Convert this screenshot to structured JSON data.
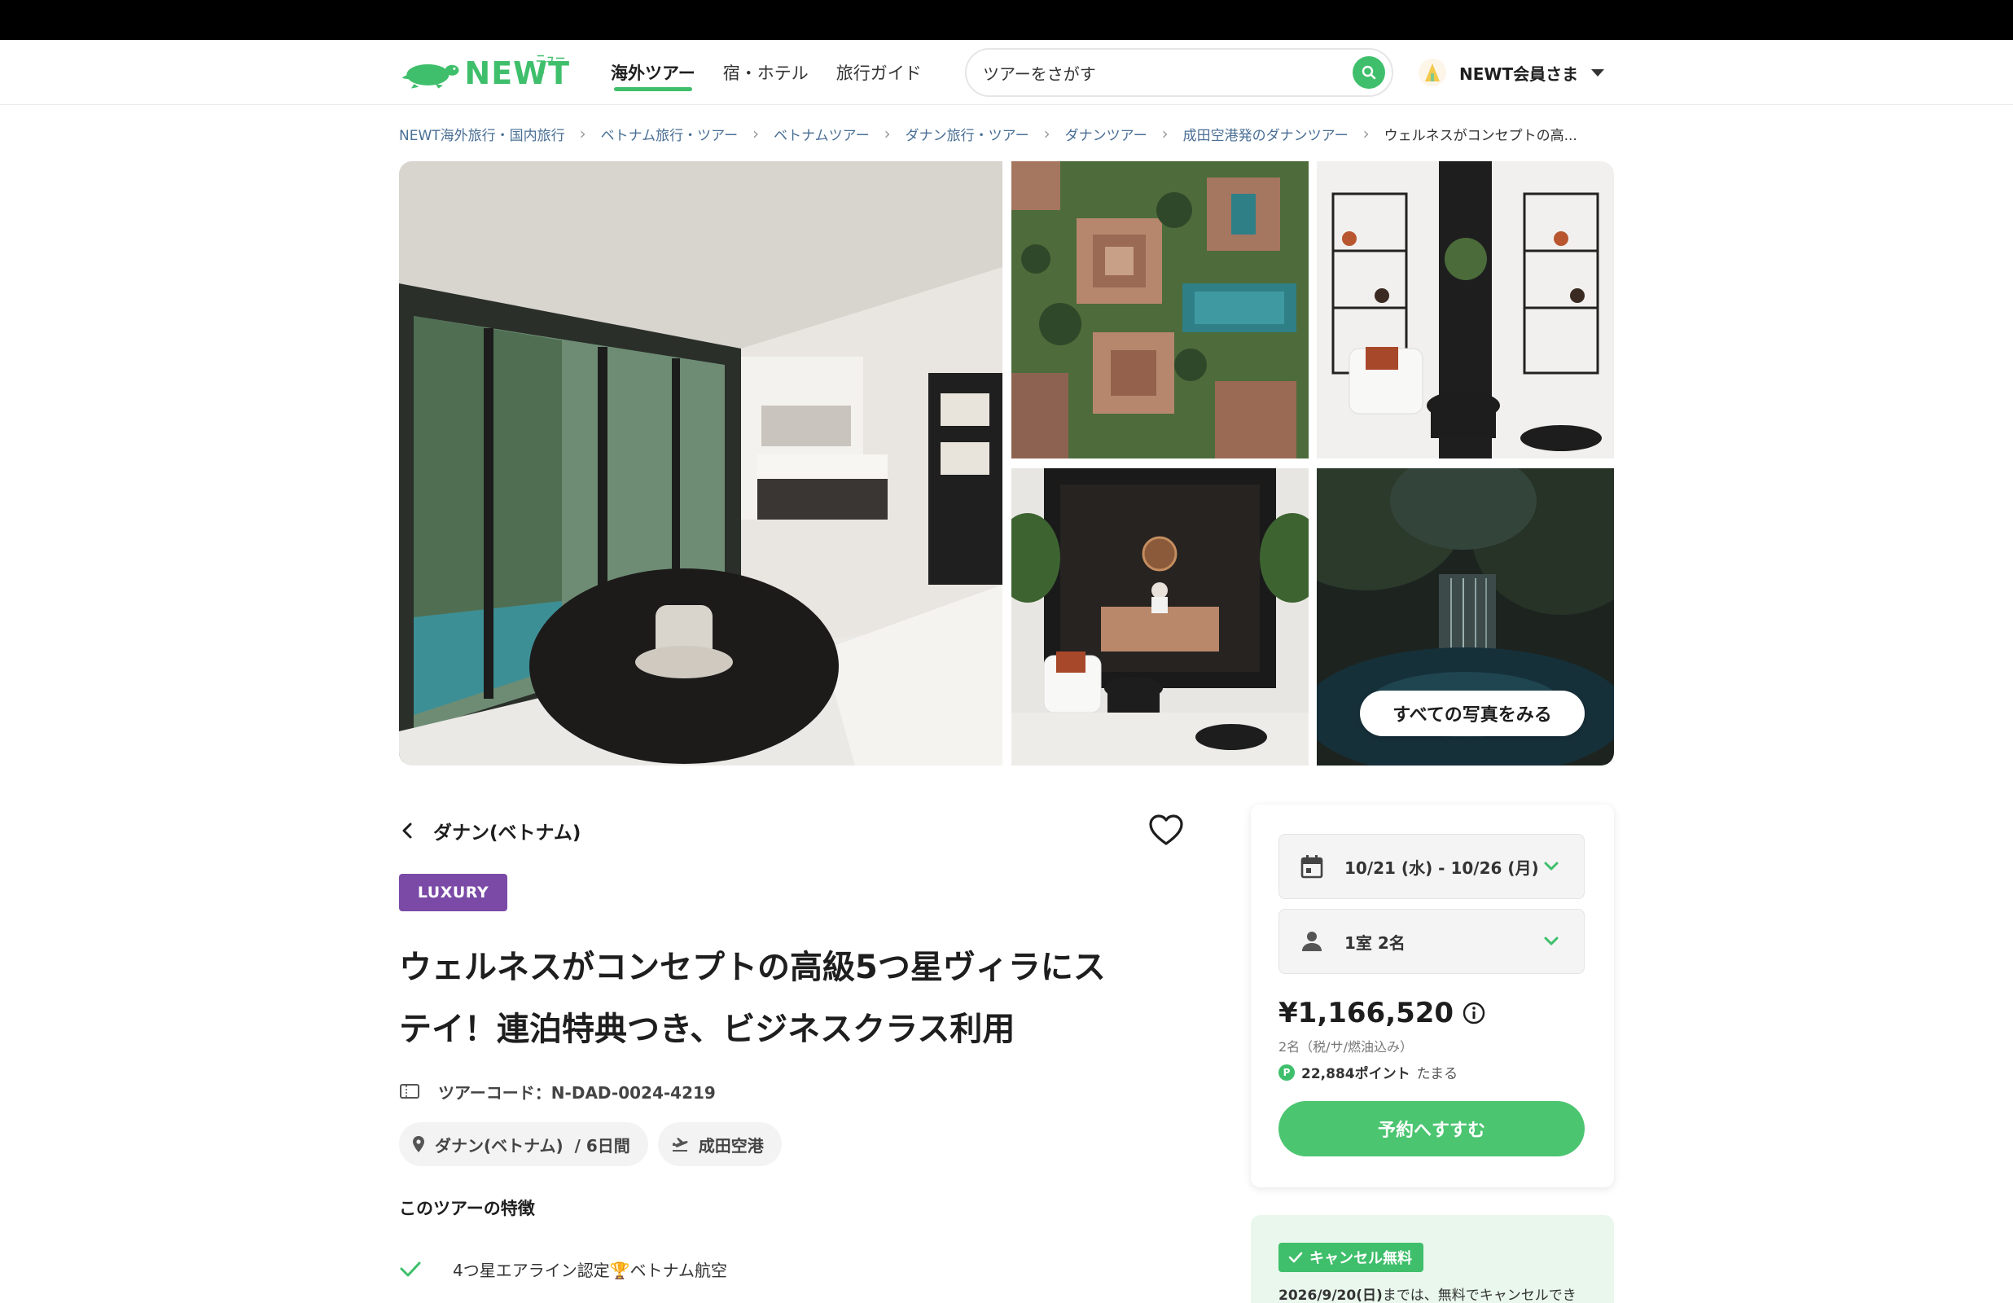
{
  "header": {
    "logo_text": "NEWT",
    "logo_ruby": "ニュート",
    "nav": [
      "海外ツアー",
      "宿・ホテル",
      "旅行ガイド"
    ],
    "search_placeholder": "ツアーをさがす",
    "user_name": "NEWT会員さま"
  },
  "breadcrumb": [
    "NEWT海外旅行・国内旅行",
    "ベトナム旅行・ツアー",
    "ベトナムツアー",
    "ダナン旅行・ツアー",
    "ダナンツアー",
    "成田空港発のダナンツアー",
    "ウェルネスがコンセプトの高..."
  ],
  "gallery": {
    "all_photos_label": "すべての写真をみる"
  },
  "tour": {
    "back_label": "ダナン(ベトナム)",
    "badge": "LUXURY",
    "title_line1": "ウェルネスがコンセプトの高級5つ星ヴィラにス",
    "title_line2": "テイ！連泊特典つき、ビジネスクラス利用",
    "code": "ツアーコード：N-DAD-0024-4219",
    "destination_chip": "ダナン(ベトナム)  / 6日間",
    "airport_chip": "成田空港",
    "features_title": "このツアーの特徴",
    "features": [
      "4つ星エアライン認定🏆ベトナム航空"
    ]
  },
  "booking": {
    "dates": "10/21 (水) - 10/26 (月)",
    "guests": "1室 2名",
    "price": "¥1,166,520",
    "price_note": "2名（税/サ/燃油込み）",
    "points": "22,884ポイント",
    "points_suffix": "たまる",
    "reserve_label": "予約へすすむ"
  },
  "cancel": {
    "badge": "キャンセル無料",
    "date": "2026/9/20(日)",
    "text": "までは、無料でキャンセルでき"
  },
  "colors": {
    "brand_green": "#3fbf6b",
    "luxury_purple": "#7b4aa6",
    "link_blue": "#4a6f95",
    "cancel_bg": "#e9f7ec"
  }
}
